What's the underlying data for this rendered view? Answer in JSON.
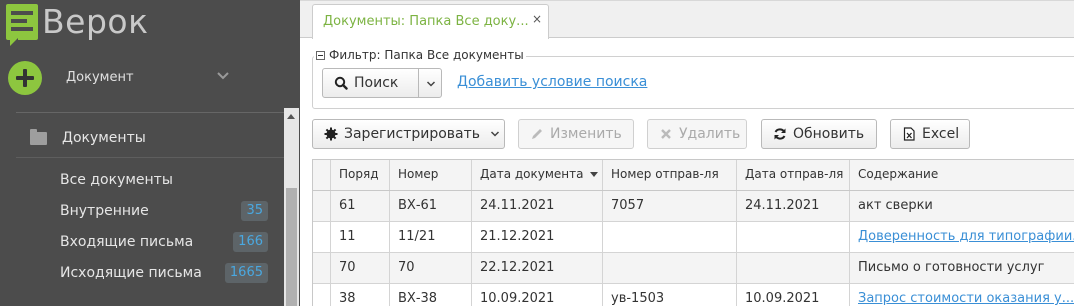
{
  "app": {
    "name": "Верок"
  },
  "sidebar": {
    "new_document_label": "Документ",
    "section_label": "Документы",
    "items": [
      {
        "label": "Все документы",
        "count": ""
      },
      {
        "label": "Внутренние",
        "count": "35"
      },
      {
        "label": "Входящие письма",
        "count": "166"
      },
      {
        "label": "Исходящие письма",
        "count": "1665"
      }
    ]
  },
  "tab": {
    "title": "Документы: Папка Все доку...",
    "close_glyph": "×"
  },
  "filter": {
    "legend": "Фильтр: Папка Все документы",
    "search_label": "Поиск",
    "add_condition": "Добавить условие поиска"
  },
  "toolbar": {
    "register": "Зарегистрировать",
    "edit": "Изменить",
    "delete": "Удалить",
    "refresh": "Обновить",
    "excel": "Excel"
  },
  "table": {
    "columns": [
      "Поряд",
      "Номер",
      "Дата документа",
      "Номер отправ-ля",
      "Дата отправ-ля",
      "Содержание"
    ],
    "rows": [
      {
        "order": "61",
        "number": "ВХ-61",
        "doc_date": "24.11.2021",
        "sender_number": "7057",
        "sender_date": "24.11.2021",
        "content": "акт сверки",
        "content_is_link": false
      },
      {
        "order": "11",
        "number": "11/21",
        "doc_date": "21.12.2021",
        "sender_number": "",
        "sender_date": "",
        "content": "Доверенность для типографии...",
        "content_is_link": true
      },
      {
        "order": "70",
        "number": "70",
        "doc_date": "22.12.2021",
        "sender_number": "",
        "sender_date": "",
        "content": "Письмо о готовности услуг",
        "content_is_link": false
      },
      {
        "order": "38",
        "number": "ВХ-38",
        "doc_date": "10.09.2021",
        "sender_number": "ув-1503",
        "sender_date": "10.09.2021",
        "content": "Запрос стоимости оказания у...",
        "content_is_link": true
      }
    ]
  },
  "colors": {
    "accent_green": "#8dc63f",
    "link_blue": "#3a8fd6",
    "sidebar_bg": "#4c4c4c"
  }
}
